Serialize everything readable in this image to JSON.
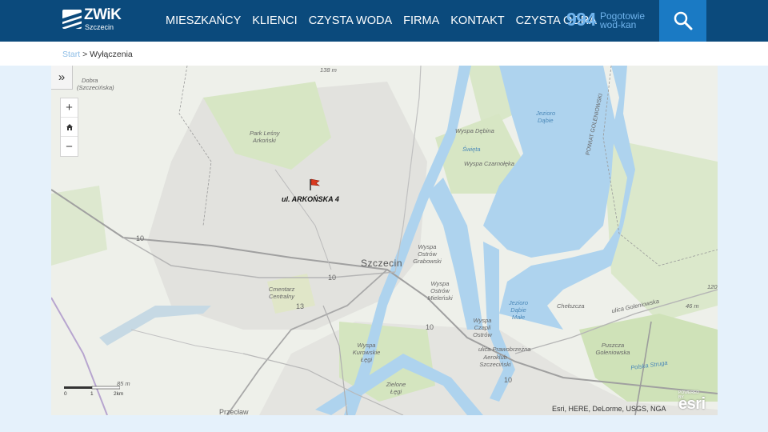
{
  "header": {
    "logo_name": "ZWiK",
    "logo_city": "Szczecin",
    "nav": [
      "MIESZKAŃCY",
      "KLIENCI",
      "CZYSTA WODA",
      "FIRMA",
      "KONTAKT",
      "CZYSTA ODRA"
    ],
    "hotline_number": "994",
    "hotline_line1": "Pogotowie",
    "hotline_line2": "wod-kan",
    "search_icon": "search-icon"
  },
  "breadcrumb": {
    "home": "Start",
    "separator": " > ",
    "current": "Wyłączenia"
  },
  "map": {
    "toggle_icon": "chevrons-right-icon",
    "zoom_in": "+",
    "home_icon": "home-icon",
    "zoom_out": "−",
    "marker_icon": "flag-icon",
    "marker_label": "ul. ARKOŃSKA 4",
    "labels": {
      "dobra": "Dobra",
      "dobra2": "(Szczecińska)",
      "elev_138": "138 m",
      "park_lesny": "Park Leśny",
      "arkonski": "Arkoński",
      "wyspa_debina": "Wyspa Dębina",
      "swieta": "Święta",
      "wyspa_czarnoleka": "Wyspa Czarnołęka",
      "jezioro_dabie": "Jezioro",
      "jezioro_dabie2": "Dąbie",
      "powiat": "POWIAT GOLENIOWSKI",
      "szczecin": "Szczecin",
      "road_10a": "10",
      "road_10b": "10",
      "road_10c": "10",
      "road_10d": "10",
      "road_13": "13",
      "wyspa_ostrow_grabowski": "Wyspa Ostrów Grabowski",
      "wyspa_ostrow_mielenski": "Wyspa Ostrów Mieleński",
      "cmentarz": "Cmentarz Centralny",
      "jezioro_male": "Jezioro Dąbie Małe",
      "wyspa_czapli": "Wyspa Czapli Ostrów",
      "wyspa_kurowskie": "Wyspa Kurowskie Łęgi",
      "zielone_legi": "Zielone Łęgi",
      "aeroklub": "Aeroklub Szczeciński",
      "prawobrzezna": "ulica Prawobrzeżna",
      "goleniowska": "ulica Goleniowska",
      "puszcza": "Puszcza Goleniowska",
      "przeclaw": "Przecław",
      "chelszcza": "Chełszcza",
      "elev_46": "46 m",
      "elev_85": "85 m",
      "elev_120": "120",
      "pomorska": "Polska Struga"
    },
    "scale": {
      "left": "0",
      "mid": "1",
      "right": "2km"
    },
    "attribution": "Esri, HERE, DeLorme, USGS, NGA",
    "esri_powered": "POWERED BY",
    "esri_logo": "esri"
  }
}
